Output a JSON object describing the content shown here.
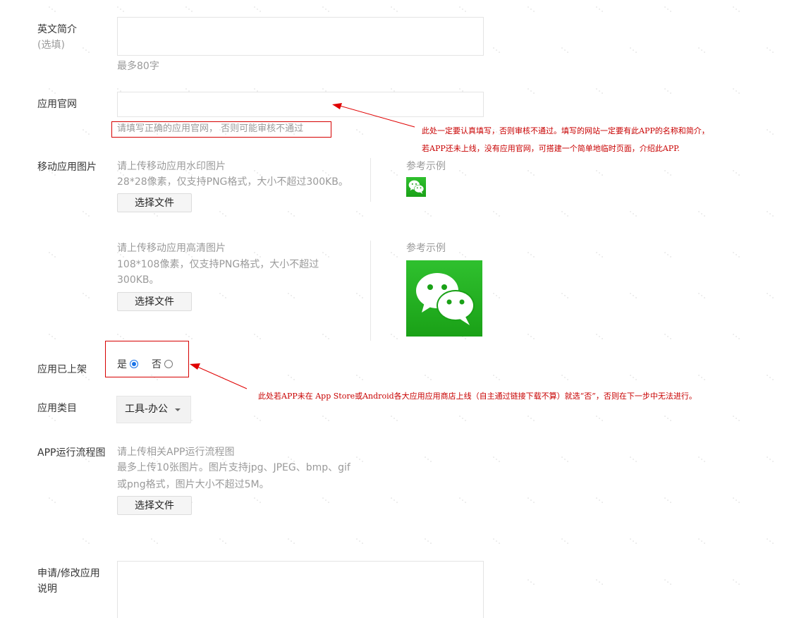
{
  "fields": {
    "english_intro": {
      "label": "英文简介",
      "optional": "(选填)",
      "hint": "最多80字"
    },
    "website": {
      "label": "应用官网",
      "error_hint": "请填写正确的应用官网， 否则可能审核不通过"
    },
    "mobile_images": {
      "label": "移动应用图片",
      "watermark_title": "请上传移动应用水印图片",
      "watermark_spec": "28*28像素，仅支持PNG格式，大小不超过300KB。",
      "hd_title": "请上传移动应用高清图片",
      "hd_spec_line1": "108*108像素，仅支持PNG格式，大小不超过",
      "hd_spec_line2": "300KB。",
      "example_label": "参考示例",
      "choose_file": "选择文件"
    },
    "listed": {
      "label": "应用已上架",
      "yes": "是",
      "no": "否",
      "selected": "是"
    },
    "category": {
      "label": "应用类目",
      "value": "工具-办公"
    },
    "flow_chart": {
      "label": "APP运行流程图",
      "title": "请上传相关APP运行流程图",
      "spec_line1": "最多上传10张图片。图片支持jpg、JPEG、bmp、gif",
      "spec_line2": "或png格式，图片大小不超过5M。",
      "choose_file": "选择文件"
    },
    "application_note": {
      "label_line1": "申请/修改应用",
      "label_line2": "说明"
    }
  },
  "annotations": {
    "website_note_line1": "此处一定要认真填写，否则审核不通过。填写的网站一定要有此APP的名称和简介，",
    "website_note_line2": "若APP还未上线，没有应用官网，可搭建一个简单地临时页面，介绍此APP.",
    "listed_note": "此处若APP未在 App Store或Android各大应用应用商店上线（自主通过链接下载不算）就选“否”，否则在下一步中无法进行。"
  },
  "icons": {
    "wechat_small": "wechat-logo-icon",
    "wechat_large": "wechat-logo-icon"
  },
  "colors": {
    "annotation_red": "#d60000",
    "wechat_green": "#1aad19",
    "radio_blue": "#1a73e8"
  }
}
